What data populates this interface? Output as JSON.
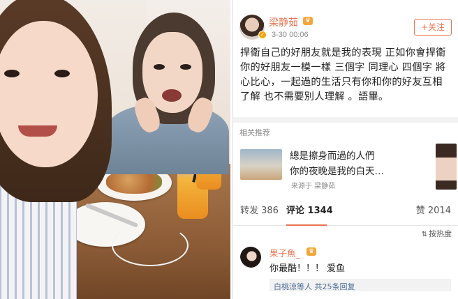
{
  "post": {
    "username": "梁静茹",
    "timestamp": "3-30 00:06",
    "follow_label": "+关注",
    "body": "捍衛自己的好朋友就是我的表現 正如你會捍衛你的好朋友一模一樣 三個字 同理心 四個字 將心比心，一起過的生活只有你和你的好友互相了解 也不需要別人理解 。語畢。"
  },
  "related": {
    "section_title": "相关推荐",
    "card": {
      "line1": "總是擦身而過的人們",
      "line2": "你的夜晚是我的白天…",
      "source": "来源于 梁静茹"
    }
  },
  "tabs": {
    "repost": "转发 386",
    "comment": "评论 1344",
    "like": "赞 2014"
  },
  "sort": {
    "label": "按热度"
  },
  "comment": {
    "name": "果子魚_",
    "text": "你最酷！！！ 爱鱼",
    "reply_summary": "白桃涼等人 共25条回复"
  },
  "colors": {
    "accent": "#eb7350",
    "vip": "#f3a73b"
  }
}
